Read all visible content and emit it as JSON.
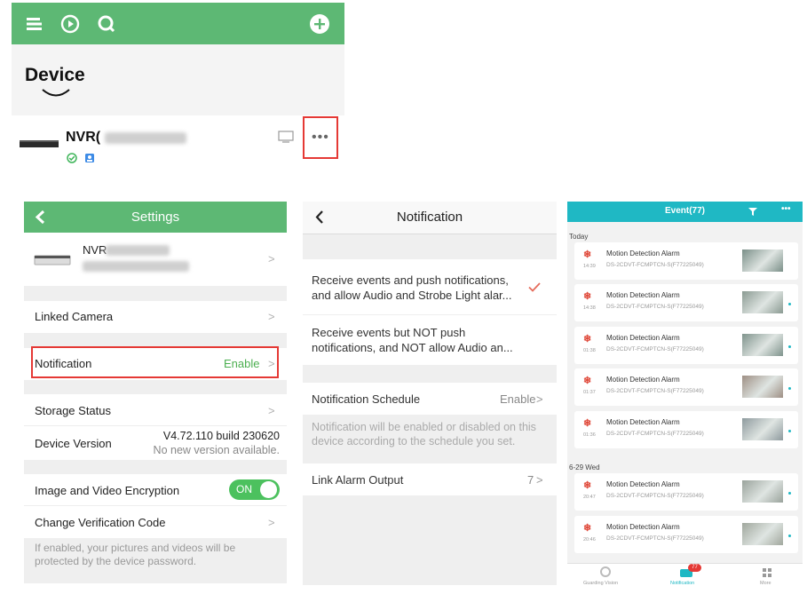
{
  "device_list": {
    "title": "Device",
    "device_name": "NVR("
  },
  "settings": {
    "title": "Settings",
    "device_name": "NVR",
    "linked_camera": "Linked Camera",
    "notification_label": "Notification",
    "notification_value": "Enable",
    "storage_status": "Storage Status",
    "device_version_label": "Device Version",
    "device_version_value": "V4.72.110 build 230620",
    "device_version_note": "No new version available.",
    "encryption_label": "Image and Video Encryption",
    "encryption_toggle": "ON",
    "change_code": "Change Verification Code",
    "footer_note_1": "If enabled, your pictures and videos will be",
    "footer_note_2": "protected by the device password."
  },
  "notification": {
    "title": "Notification",
    "option1_line1": "Receive events and push notifications,",
    "option1_line2": "and allow Audio and Strobe Light alar...",
    "option2_line1": "Receive events but NOT push",
    "option2_line2": "notifications, and NOT allow Audio an...",
    "schedule_label": "Notification Schedule",
    "schedule_value": "Enable",
    "schedule_note_1": "Notification will be enabled or disabled on this",
    "schedule_note_2": "device according to the schedule you set.",
    "link_alarm_label": "Link Alarm Output",
    "link_alarm_value": "7"
  },
  "events": {
    "title": "Event(77)",
    "section_today": "Today",
    "section_wed": "6-29 Wed",
    "items": [
      {
        "title": "Motion Detection Alarm",
        "time": "14:39",
        "device": "DS-2CDVT-FCMPTCN-S(F77225049)"
      },
      {
        "title": "Motion Detection Alarm",
        "time": "14:38",
        "device": "DS-2CDVT-FCMPTCN-S(F77225049)"
      },
      {
        "title": "Motion Detection Alarm",
        "time": "01:38",
        "device": "DS-2CDVT-FCMPTCN-S(F77225049)"
      },
      {
        "title": "Motion Detection Alarm",
        "time": "01:37",
        "device": "DS-2CDVT-FCMPTCN-S(F77225049)"
      },
      {
        "title": "Motion Detection Alarm",
        "time": "01:36",
        "device": "DS-2CDVT-FCMPTCN-S(F77225049)"
      },
      {
        "title": "Motion Detection Alarm",
        "time": "20:47",
        "device": "DS-2CDVT-FCMPTCN-S(F77225049)"
      },
      {
        "title": "Motion Detection Alarm",
        "time": "20:46",
        "device": "DS-2CDVT-FCMPTCN-S(F77225049)"
      }
    ],
    "nav": {
      "guarding": "Guarding Vision",
      "notification": "Notification",
      "notification_badge": "77",
      "more": "More"
    }
  },
  "colors": {
    "brand_green": "#5db874",
    "accent_teal": "#1fb8c4",
    "highlight_red": "#e53935"
  }
}
